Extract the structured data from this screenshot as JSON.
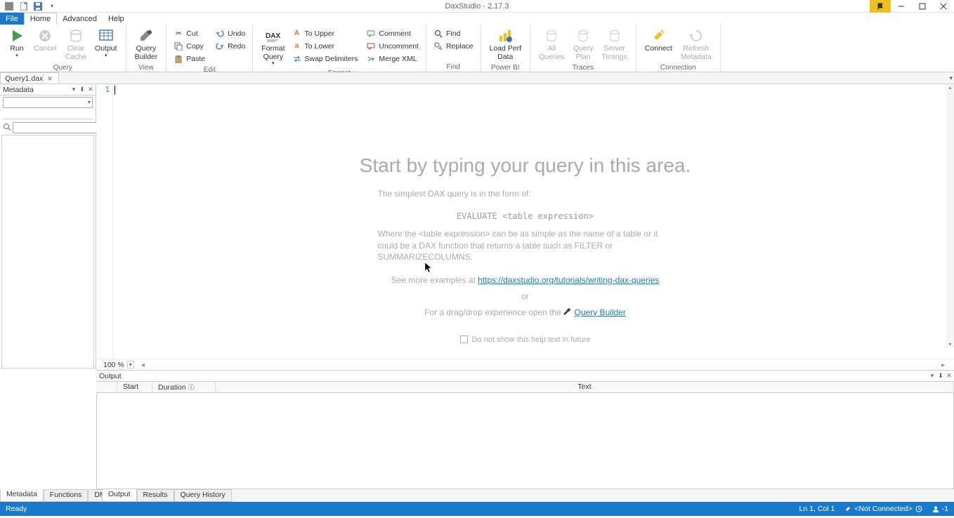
{
  "app": {
    "title": "DaxStudio - 2.17.3"
  },
  "menus": {
    "file": "File",
    "home": "Home",
    "advanced": "Advanced",
    "help": "Help"
  },
  "ribbon": {
    "query": {
      "run": "Run",
      "cancel": "Cancel",
      "clear_cache": "Clear\nCache",
      "output": "Output",
      "label": "Query"
    },
    "view": {
      "query_builder": "Query\nBuilder",
      "label": "View"
    },
    "edit": {
      "cut": "Cut",
      "copy": "Copy",
      "paste": "Paste",
      "undo": "Undo",
      "redo": "Redo",
      "label": "Edit"
    },
    "format": {
      "format_query": "Format\nQuery",
      "to_upper": "To Upper",
      "to_lower": "To Lower",
      "swap_delim": "Swap Delimiters",
      "comment": "Comment",
      "uncomment": "Uncomment",
      "merge_xml": "Merge XML",
      "label": "Format"
    },
    "find": {
      "find": "Find",
      "replace": "Replace",
      "label": "Find"
    },
    "powerbi": {
      "load_perf": "Load Perf\nData",
      "label": "Power BI"
    },
    "traces": {
      "all_queries": "All\nQueries",
      "query_plan": "Query\nPlan",
      "server_timings": "Server\nTimings",
      "label": "Traces"
    },
    "connection": {
      "connect": "Connect",
      "refresh": "Refresh\nMetadata",
      "label": "Connection"
    }
  },
  "doc_tab": {
    "name": "Query1.dax"
  },
  "metadata_panel": {
    "title": "Metadata"
  },
  "editor": {
    "line_number": "1",
    "zoom": "100 %",
    "placeholder_title": "Start by typing your query in this area.",
    "simplest": "The simplest DAX query is in the form of:",
    "code_example": "EVALUATE <table expression>",
    "where_text": "Where the <table expression> can be as simple as the name of a table or it could be a DAX function that returns a table such as FILTER or SUMMARIZECOLUMNS.",
    "see_more": "See more examples at ",
    "tutorial_link": "https://daxstudio.org/tutorials/writing-dax-queries",
    "or_text": "or",
    "drag_drop": "For a drag/drop experience open the ",
    "qb_link": "Query Builder",
    "checkbox_text": "Do not show this help text in future"
  },
  "output_panel": {
    "title": "Output",
    "col_start": "Start",
    "col_duration": "Duration",
    "col_text": "Text"
  },
  "left_tabs": {
    "metadata": "Metadata",
    "functions": "Functions",
    "dmv": "DMV"
  },
  "right_tabs": {
    "output": "Output",
    "results": "Results",
    "query_history": "Query History"
  },
  "status": {
    "ready": "Ready",
    "position": "Ln 1, Col 1",
    "connection": "<Not Connected>",
    "user_count": "-1"
  }
}
